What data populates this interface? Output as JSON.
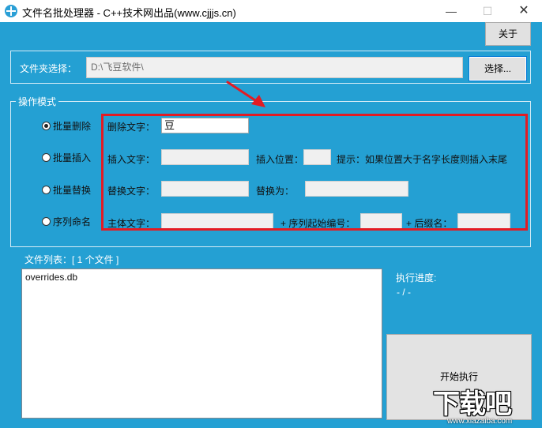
{
  "window": {
    "title": "文件名批处理器 - C++技术网出品(www.cjjjs.cn)",
    "minimize_glyph": "—",
    "maximize_glyph": "☐",
    "close_glyph": "✕"
  },
  "header": {
    "about_label": "关于"
  },
  "folder": {
    "label": "文件夹选择：",
    "path": "D:\\飞豆软件\\",
    "select_label": "选择..."
  },
  "mode": {
    "legend": "操作模式",
    "options": [
      {
        "label": "批量删除",
        "checked": true
      },
      {
        "label": "批量插入",
        "checked": false
      },
      {
        "label": "批量替换",
        "checked": false
      },
      {
        "label": "序列命名",
        "checked": false
      }
    ],
    "delete": {
      "label": "删除文字：",
      "value": "豆"
    },
    "insert": {
      "label": "插入文字：",
      "value": "",
      "position_label": "插入位置：",
      "position_value": "",
      "hint": "提示：如果位置大于名字长度则插入末尾"
    },
    "replace": {
      "label": "替换文字：",
      "value": "",
      "to_label": "替换为：",
      "to_value": ""
    },
    "sequence": {
      "main_label": "主体文字：",
      "main_value": "",
      "start_label": "+ 序列起始编号：",
      "start_value": "",
      "suffix_label": "+ 后缀名：",
      "suffix_value": ""
    }
  },
  "files": {
    "label": "文件列表：[ 1 个文件 ]",
    "items": [
      "overrides.db"
    ]
  },
  "progress": {
    "label": "执行进度:",
    "value": "- / -"
  },
  "run": {
    "label": "开始执行"
  },
  "watermark": {
    "logo": "下载吧",
    "url": "www.xiazaiba.com"
  },
  "colors": {
    "client_bg": "#24a0d3",
    "highlight_border": "#e31b23",
    "arrow": "#e31b23"
  }
}
